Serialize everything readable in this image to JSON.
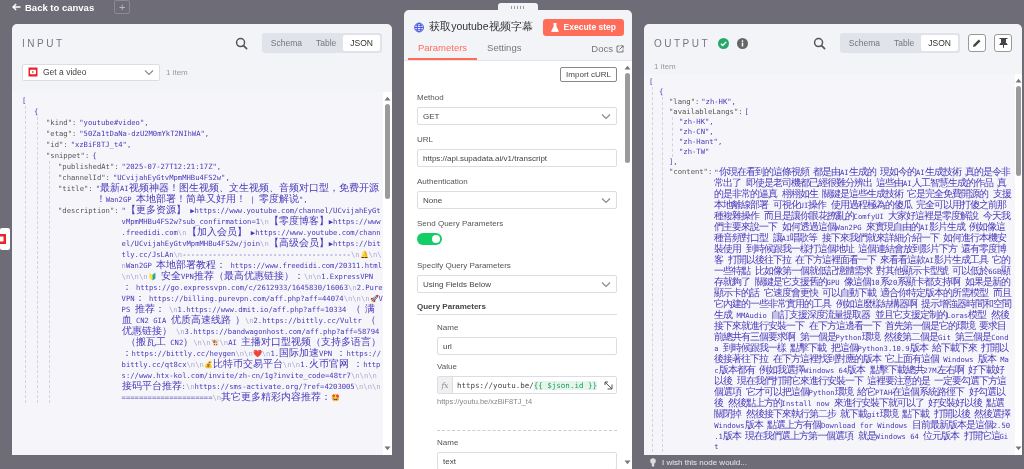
{
  "top_bar": {
    "back_link": "Back to canvas",
    "add_button": "+"
  },
  "input_panel": {
    "title": "INPUT",
    "view_tabs": [
      {
        "label": "Schema",
        "selected": false
      },
      {
        "label": "Table",
        "selected": false
      },
      {
        "label": "JSON",
        "selected": true
      }
    ],
    "node_select": {
      "value": "Get a video"
    },
    "item_count": "1 item",
    "json": [
      {
        "open": "[",
        "children": [
          {
            "open": "{",
            "children": [
              {
                "key": "\"kind\":",
                "value": "\"youtube#video\","
              },
              {
                "key": "\"etag\":",
                "value": "\"50Za1tDaNa-dzU2M0mYkT2NIhWA\","
              },
              {
                "key": "\"id\":",
                "value": "\"xzBiF8TJ_t4\","
              },
              {
                "key": "\"snippet\":",
                "open": "{",
                "children": [
                  {
                    "key": "\"publishedAt\":",
                    "value": "\"2025-07-27T12:21:17Z\","
                  },
                  {
                    "key": "\"channelId\":",
                    "value": "\"UCvijahEyGtvMpmMHBu4FS2w\","
                  },
                  {
                    "key": "\"title\":",
                    "value": "\"最新AI视频神器！图生视频、文生视频、音频对口型，免费开源！Wan2GP 本地部署！简单又好用！ | 零度解说\","
                  },
                  {
                    "key": "\"description\":",
                    "value": "\"【更多资源】 ▶https://www.youtube.com/channel/UCvijahEyGtvMpmMHBu4FS2w?sub_confirmation=1\\n【零度博客】▶https://www.freedidi.com\\n【加入会员】 ▶https://www.youtube.com/channel/UCvijahEyGtvMpmMHBu4FS2w/join\\n【高级会员】▶https://bittly.cc/JsLAn\\n---------------------------------------\\n🔔\\n\\nWan2GP 本地部署教程： https://www.freedidi.com/20311.html\\n\\n\\n🔰 安全VPN推荐（最高优惠链接）：\\n\\n1.ExpressVPN： https://go.expressvpn.com/c/2612933/1645830/16063\\n2.PureVPN： https://billing.purevpn.com/aff.php?aff=44074\\n\\n\\n🚀VPS 推荐： \\n1.https://www.dmit.io/aff.php?aff=10334 （ 满血 CN2 GIA 优质高速线路 ）\\n2.https://bittly.cc/Vultr （优惠链接） \\n3.https://bandwagonhost.com/aff.php?aff=58794 （搬瓦工 CN2）\\n\\n🐮\\nAI 主播对口型视频（支持多语言）：https://bittly.cc/heygen\\n\\n❤️\\n1.国际加速VPN ：https://bittly.cc/qt8cx\\n\\n💰比特币交易平台\\n\\n1.火币官网 ：https://www.htx-kol.com/invite/zh-cn/1g?invite_code=48tr7\\n\\n\\n接码平台推荐:\\nhttps://sms-activate.org/?ref=4203005\\n\\n\\n=====================\\n其它更多精彩内容推荐：🤩"
                  }
                ]
              }
            ]
          }
        ]
      }
    ]
  },
  "node_panel": {
    "title": "获取youtube视频字幕",
    "execute_button": "Execute step",
    "tabs": [
      {
        "label": "Parameters",
        "selected": true
      },
      {
        "label": "Settings",
        "selected": false
      }
    ],
    "docs_link": "Docs",
    "import_button": "Import cURL",
    "fields": [
      {
        "kind": "select",
        "label": "Method",
        "value": "GET"
      },
      {
        "kind": "text",
        "label": "URL",
        "value": "https://api.supadata.ai/v1/transcript"
      },
      {
        "kind": "select",
        "label": "Authentication",
        "value": "None"
      },
      {
        "kind": "toggle",
        "label": "Send Query Parameters",
        "on": true
      },
      {
        "kind": "select",
        "label": "Specify Query Parameters",
        "value": "Using Fields Below"
      },
      {
        "kind": "section",
        "label": "Query Parameters"
      }
    ],
    "query_parameters": [
      {
        "name_label": "Name",
        "name": "url",
        "value_label": "Value",
        "fx_label": "fx",
        "expression_prefix": "https://youtu.be/",
        "expression": "{{ $json.id }}",
        "preview": "https://youtu.be/xzBiF8TJ_t4"
      },
      {
        "name_label": "Name",
        "name": "text"
      }
    ]
  },
  "output_panel": {
    "title": "OUTPUT",
    "succeeded": true,
    "view_tabs": [
      {
        "label": "Schema",
        "selected": false
      },
      {
        "label": "Table",
        "selected": false
      },
      {
        "label": "JSON",
        "selected": true
      }
    ],
    "item_count": "1 item",
    "json": [
      {
        "open": "[",
        "children": [
          {
            "open": "{",
            "children": [
              {
                "key": "\"lang\":",
                "value": "\"zh-HK\","
              },
              {
                "key": "\"availableLangs\":",
                "open": "[",
                "close": "],",
                "children": [
                  {
                    "value": "\"zh-HK\","
                  },
                  {
                    "value": "\"zh-CN\","
                  },
                  {
                    "value": "\"zh-Hant\","
                  },
                  {
                    "value": "\"zh-TW\""
                  }
                ]
              },
              {
                "key": "\"content\":",
                "value": "\"你現在看到的這條視頻 都是由AI生成的 現如今的AI生成技術 真的是令非常出了 即使是老司機都已經很難分辨出 這些由AI人工智慧生成的作品 真的是非常的逼真 栩栩如生 關鍵是這些生成技術 它是完全免費開源的 支援本地離線部署 可視化UI操作 使用過程極為的傻瓜 完全可以用打傻之前那種複雜操作 而且是讓你眼花撩亂的ComfyUI 大家好這裡是零度解說 今天我們主要來說一下 如何透過這個Wan2PG 來實現自由的AI影片生成 例如像這種音頻對口型 讓AI唱歌等 接下來我們就來詳細介紹一下 如何進行本機安裝使用 到時候跟我一樣打這個地址 這個連結會放到影片下方 還有零度博客 打開以後往下拉 在下方這裡面看一下 來看看這款AI影片生成工具 它的一些特點 比如像第一個就低記憶體需求 對其他顯示卡型號 可以低於6GB顯存就夠了 關鍵是它支援舊的GPU 像這個10系20系顯卡都支持啊 如果是新的顯示卡的話 它速度會更快 可以自動下載 適合你特定版本的所需模型 而且它內建的一些非常實用的工具 例如這麼樣結構器啊 提示增強器時間和空間生成 MMAudio 自訂支援深度流量提取器 並且它支援定制的Loras模型 然後接下來就進行安裝一下 在下方這邊看一下 首先第一個是它的環境 要求目前總共有三個要求啊 第一個是Python環境 然後第二個是Git 第三個是Conda 到時候跟我一樣 點擊下載 把這個Python3.10.9版本 給下載下來 打開以後接著往下拉 在下方這裡找到對應的版本 它上面有這個 Windows 版本 Mac版本都有 例如我選擇Windows 64版本 點擊下載總共27M左右啊 好下載好以後 現在我們打開它來進行安裝一下 這裡要注意的是 一定要勾選下方這個選項 它才可以把這個Python環境 給它PTAH在這個系統路徑下 好勾選以後 然後點上方的Install now 來進行安裝下就可以了 好安裝好以後 點選關閉掉 然後接下來執行第二步 就下載git環境 點下載 打開以後 然後選擇Windows版本 點選上方有個Download for Windows 目前最新版本是這個2.50.1版本 現在我們選上方第一個選項 就是Windows 64 位元版本 打開它這Git"
              }
            ]
          }
        ]
      }
    ]
  },
  "feedback_bar": {
    "text": "I wish this node would..."
  }
}
